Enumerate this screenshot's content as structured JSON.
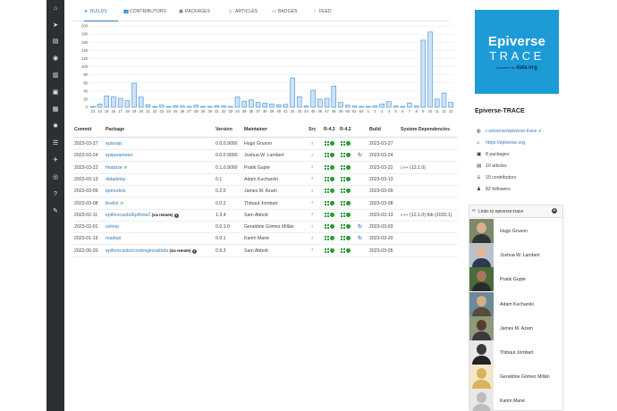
{
  "tabs": [
    {
      "label": "BUILDS",
      "icon": "rocket-icon",
      "active": true
    },
    {
      "label": "CONTRIBUTORS",
      "icon": "users-icon",
      "active": false
    },
    {
      "label": "PACKAGES",
      "icon": "cubes-icon",
      "active": false
    },
    {
      "label": "ARTICLES",
      "icon": "file-icon",
      "active": false
    },
    {
      "label": "BADGES",
      "icon": "id-badge-icon",
      "active": false
    },
    {
      "label": "FEED",
      "icon": "rss-icon",
      "active": false
    }
  ],
  "sidebar_icons": [
    "home-icon",
    "rocket-icon",
    "book-icon",
    "globe-icon",
    "chart-icon",
    "cubes-icon",
    "table-icon",
    "gear-icon",
    "server-icon",
    "satellite-icon",
    "eye-icon",
    "help-icon",
    "wrench-icon"
  ],
  "chart_data": {
    "type": "bar",
    "title": "",
    "xlabel": "",
    "ylabel": "",
    "ylim": [
      0,
      200
    ],
    "yticks": [
      0,
      20,
      40,
      60,
      80,
      100,
      120,
      140,
      160,
      180,
      200
    ],
    "color": "#3d8fd8",
    "tick_labels": [
      "13",
      "14",
      "15",
      "16",
      "17",
      "18",
      "19",
      "20",
      "21",
      "22",
      "23",
      "24",
      "25",
      "26",
      "27",
      "28",
      "29",
      "30",
      "31",
      "32",
      "33",
      "34",
      "35",
      "36",
      "37",
      "38",
      "39",
      "40",
      "41",
      "42",
      "43",
      "44",
      "45",
      "46",
      "47",
      "48",
      "49",
      "50",
      "51",
      "52",
      "1",
      "2",
      "3",
      "4",
      "5",
      "6",
      "7",
      "8",
      "9",
      "10",
      "11",
      "12",
      "13"
    ],
    "values": [
      2,
      8,
      28,
      26,
      22,
      16,
      59,
      25,
      6,
      2,
      5,
      2,
      4,
      3,
      2,
      5,
      2,
      2,
      4,
      3,
      2,
      25,
      15,
      18,
      12,
      10,
      8,
      6,
      7,
      72,
      26,
      3,
      42,
      20,
      22,
      52,
      12,
      5,
      3,
      2,
      2,
      3,
      8,
      14,
      3,
      2,
      10,
      3,
      165,
      185,
      20,
      35,
      12
    ]
  },
  "table": {
    "headers": {
      "commit": "Commit",
      "package": "Package",
      "version": "Version",
      "maintainer": "Maintainer",
      "src": "Src",
      "r43": "R-4.3",
      "r42": "R-4.2",
      "build": "Build",
      "sysdeps": "System Dependencies"
    },
    "rows": [
      {
        "commit": "2023-03-27",
        "package": "episoap",
        "remote": "",
        "award": false,
        "info": false,
        "version": "0.0.0.9000",
        "maintainer": "Hugo Gruson",
        "src_ok": true,
        "sync": false,
        "build": "2023-03-27",
        "deps": "",
        "deps_version": ""
      },
      {
        "commit": "2023-03-24",
        "package": "epiparameter",
        "remote": "",
        "award": false,
        "info": false,
        "version": "0.0.0.9000",
        "maintainer": "Joshua W. Lambert",
        "src_ok": true,
        "sync": true,
        "build": "2023-03-24",
        "deps": "",
        "deps_version": ""
      },
      {
        "commit": "2023-03-22",
        "package": "finalsize",
        "remote": "",
        "award": true,
        "info": false,
        "version": "0.1.0.9000",
        "maintainer": "Pratik Gupte",
        "src_ok": true,
        "sync": false,
        "build": "2023-03-22",
        "deps": "c++",
        "deps_version": "(12.1.0)"
      },
      {
        "commit": "2023-03-13",
        "package": "datadelay",
        "remote": "",
        "award": false,
        "info": false,
        "version": "0.1",
        "maintainer": "Adam Kucharski",
        "src_ok": true,
        "sync": false,
        "build": "2023-03-13",
        "deps": "",
        "deps_version": ""
      },
      {
        "commit": "2023-03-09",
        "package": "bpmodels",
        "remote": "",
        "award": false,
        "info": false,
        "version": "0.2.0",
        "maintainer": "James M. Azam",
        "src_ok": true,
        "sync": false,
        "build": "2023-03-09",
        "deps": "",
        "deps_version": ""
      },
      {
        "commit": "2023-03-08",
        "package": "linelist",
        "remote": "",
        "award": true,
        "info": false,
        "version": "0.0.2",
        "maintainer": "Thibaut Jombart",
        "src_ok": true,
        "sync": false,
        "build": "2023-03-08",
        "deps": "",
        "deps_version": ""
      },
      {
        "commit": "2023-02-11",
        "package": "epiforecasts/EpiNow2",
        "remote": "(via remote)",
        "award": false,
        "info": true,
        "version": "1.3.4",
        "maintainer": "Sam Abbott",
        "src_ok": true,
        "sync": false,
        "build": "2023-03-13",
        "deps": "c++",
        "deps_version": "(12.1.0) tbb (2020.1)"
      },
      {
        "commit": "2023-02-01",
        "package": "sivirep",
        "remote": "",
        "award": false,
        "info": false,
        "version": "0.0.1.0",
        "maintainer": "Geraldine Gómez Millán",
        "src_ok": false,
        "sync": true,
        "build": "2023-03-03",
        "deps": "",
        "deps_version": ""
      },
      {
        "commit": "2023-01-19",
        "package": "readepi",
        "remote": "",
        "award": false,
        "info": false,
        "version": "0.0.1",
        "maintainer": "Karim Mané",
        "src_ok": true,
        "sync": true,
        "build": "2023-03-20",
        "deps": "",
        "deps_version": ""
      },
      {
        "commit": "2022-06-20",
        "package": "epiforecasts/covidregionaldata",
        "remote": "(via remote)",
        "award": false,
        "info": true,
        "version": "0.9.3",
        "maintainer": "Sam Abbott",
        "src_ok": true,
        "sync": false,
        "build": "2023-03-05",
        "deps": "",
        "deps_version": ""
      }
    ]
  },
  "logo": {
    "line1": "Epiverse",
    "line2": "TRACE",
    "powered": "powered by",
    "brand": "data.org",
    "bg_color": "#1d9bd7"
  },
  "universe": {
    "title": "Epiverse-TRACE",
    "repo": "r-universe/epiverse-trace",
    "website": "https://epiverse.org",
    "packages": "8 packages",
    "articles": "10 articles",
    "contributors": "19 contributors",
    "followers": "82 followers"
  },
  "links": {
    "title": "Links to epiverse-trace",
    "people": [
      {
        "name": "Hugo Gruson",
        "avatar": {
          "bg": "#7a8a6a",
          "head": "#d7b08c",
          "torso": "#333333"
        }
      },
      {
        "name": "Joshua W. Lambert",
        "avatar": {
          "bg": "#b9c2cc",
          "head": "#e0b894",
          "torso": "#2b3a52"
        }
      },
      {
        "name": "Pratik Gupte",
        "avatar": {
          "bg": "#4a6b3a",
          "head": "#a8785a",
          "torso": "#2a2a2a"
        }
      },
      {
        "name": "Adam Kucharski",
        "avatar": {
          "bg": "#6b8a9a",
          "head": "#d7aa88",
          "torso": "#5a4a3a"
        }
      },
      {
        "name": "James M. Azam",
        "avatar": {
          "bg": "#8a9a7a",
          "head": "#5a3a2a",
          "torso": "#3a3a3a"
        }
      },
      {
        "name": "Thibaut Jombart",
        "avatar": {
          "bg": "#e8e8e8",
          "head": "#3a3a3a",
          "torso": "#222222"
        }
      },
      {
        "name": "Geraldine Gómez Millán",
        "avatar": {
          "bg": "#f3e6c8",
          "head": "#d9b25a",
          "torso": "#d9b25a"
        }
      },
      {
        "name": "Karim Mané",
        "avatar": {
          "bg": "#e8e8e8",
          "head": "#bdbdbd",
          "torso": "#bdbdbd"
        }
      }
    ]
  }
}
